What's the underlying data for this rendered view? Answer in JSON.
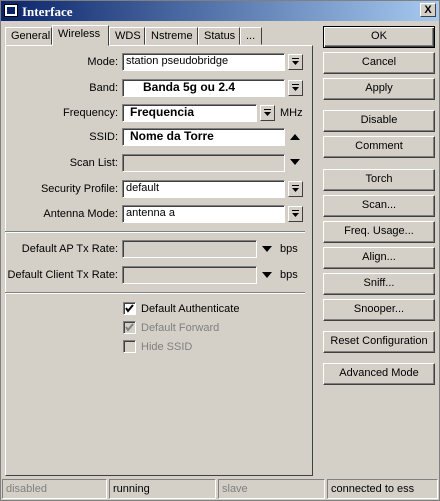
{
  "window": {
    "title": "Interface",
    "close_glyph": "X"
  },
  "tabs": [
    "General",
    "Wireless",
    "WDS",
    "Nstreme",
    "Status",
    "..."
  ],
  "active_tab": "Wireless",
  "form": {
    "mode": {
      "label": "Mode:",
      "value": "station pseudobridge"
    },
    "band": {
      "label": "Band:",
      "value": "Banda 5g ou 2.4"
    },
    "frequency": {
      "label": "Frequency:",
      "value": "Frequencia",
      "unit": "MHz"
    },
    "ssid": {
      "label": "SSID:",
      "value": "Nome da Torre"
    },
    "scan_list": {
      "label": "Scan List:",
      "value": ""
    },
    "security_profile": {
      "label": "Security Profile:",
      "value": "default"
    },
    "antenna_mode": {
      "label": "Antenna Mode:",
      "value": "antenna a"
    },
    "default_ap_tx_rate": {
      "label": "Default AP Tx Rate:",
      "value": "",
      "unit": "bps"
    },
    "default_client_tx_rate": {
      "label": "Default Client Tx Rate:",
      "value": "",
      "unit": "bps"
    }
  },
  "checkboxes": [
    {
      "label": "Default Authenticate",
      "checked": true,
      "enabled": true
    },
    {
      "label": "Default Forward",
      "checked": true,
      "enabled": false
    },
    {
      "label": "Hide SSID",
      "checked": false,
      "enabled": false
    }
  ],
  "buttons": [
    "OK",
    "Cancel",
    "Apply",
    "Disable",
    "Comment",
    "Torch",
    "Scan...",
    "Freq. Usage...",
    "Align...",
    "Sniff...",
    "Snooper...",
    "Reset Configuration",
    "Advanced Mode"
  ],
  "status": [
    "disabled",
    "running",
    "slave",
    "connected to ess"
  ]
}
